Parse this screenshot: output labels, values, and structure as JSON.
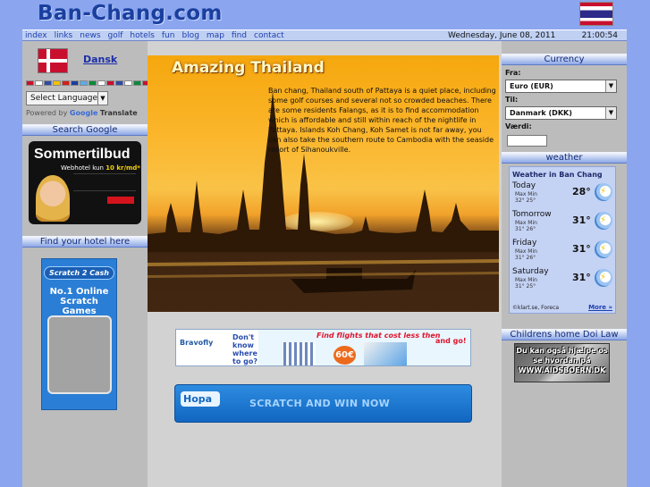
{
  "site": {
    "logo": "Ban-Chang.com"
  },
  "nav": {
    "items": [
      "index",
      "links",
      "news",
      "golf",
      "hotels",
      "fun",
      "blog",
      "map",
      "find",
      "contact"
    ],
    "date": "Wednesday, June 08, 2011",
    "time": "21:00:54"
  },
  "left": {
    "lang_link": "Dansk",
    "translate": {
      "select_label": "Select Language",
      "powered": "Powered by",
      "google": "Google",
      "translate": "Translate"
    },
    "search_heading": "Search Google",
    "ad_sommer": {
      "title": "Sommertilbud",
      "line": "Webhotel kun",
      "price": "10 kr/md*"
    },
    "hotel_heading": "Find your hotel here",
    "ad_scratch": {
      "logo": "Scratch 2 Cash",
      "text": "No.1 Online Scratch Games"
    }
  },
  "center": {
    "hero_title": "Amazing Thailand",
    "hero_text": "Ban chang, Thailand south of Pattaya is a quiet place, including some golf courses and several not so crowded beaches. There are some residents Falangs, as it is to find accommodation which is affordable and still within reach of the nightlife in Pattaya. Islands Koh Chang, Koh Samet is not far away, you can also take the southern route to Cambodia with the seaside resort of Sihanoukville.",
    "ad_flights": {
      "brand": "Bravofly",
      "question": "Don't know where to go?",
      "headline": "Find flights that cost less then",
      "price": "60€",
      "cta": "and go!"
    },
    "ad_hopa": {
      "logo": "Hopa",
      "text": "SCRATCH AND WIN NOW"
    }
  },
  "right": {
    "currency_heading": "Currency",
    "from_label": "Fra:",
    "from_value": "Euro (EUR)",
    "to_label": "Til:",
    "to_value": "Danmark (DKK)",
    "amount_label": "Værdi:",
    "weather_heading": "weather",
    "weather": {
      "title": "Weather in Ban Chang",
      "minmax_label": "Max Min",
      "days": [
        {
          "day": "Today",
          "max_min": "32° 25°",
          "temp": "28°"
        },
        {
          "day": "Tomorrow",
          "max_min": "31° 26°",
          "temp": "31°"
        },
        {
          "day": "Friday",
          "max_min": "31° 26°",
          "temp": "31°"
        },
        {
          "day": "Saturday",
          "max_min": "31° 25°",
          "temp": "31°"
        }
      ],
      "credit": "©klart.se, Foreca",
      "more": "More »"
    },
    "children_heading": "Childrens home Doi Law",
    "ad_aids": "Du kan også hjælpe os se hvordan på WWW.AIDSBOERN.DK"
  }
}
